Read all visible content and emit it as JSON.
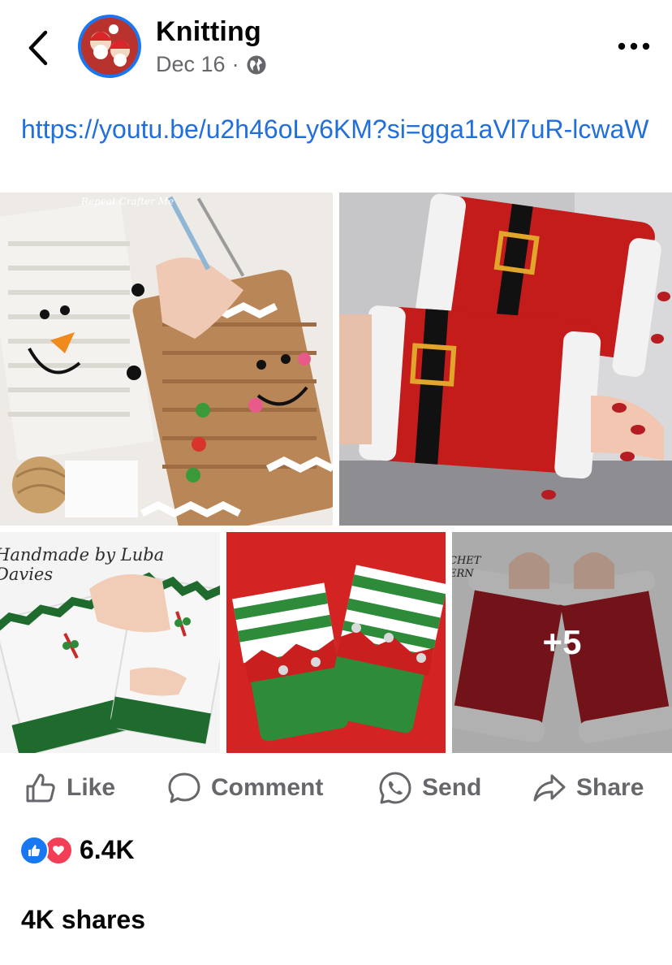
{
  "post": {
    "group_name": "Knitting",
    "date": "Dec 16",
    "separator": "·",
    "privacy_icon": "globe-icon",
    "link": "https://youtu.be/u2h46oLy6KM?si=gga1aVl7uR-lcwaW"
  },
  "photos": {
    "more_count": "+5",
    "watermark_1": "Repeat Crafter Me",
    "watermark_3": "Handmade by Luba Davies",
    "watermark_5": "CHET ERN"
  },
  "actions": {
    "like": "Like",
    "comment": "Comment",
    "send": "Send",
    "share": "Share"
  },
  "stats": {
    "reactions_count": "6.4K",
    "reaction_icons": [
      "like-icon",
      "love-icon"
    ],
    "shares": "4K shares"
  },
  "colors": {
    "accent": "#1877f2",
    "link": "#216fdb",
    "love": "#f33e58",
    "muted": "#65676b"
  }
}
